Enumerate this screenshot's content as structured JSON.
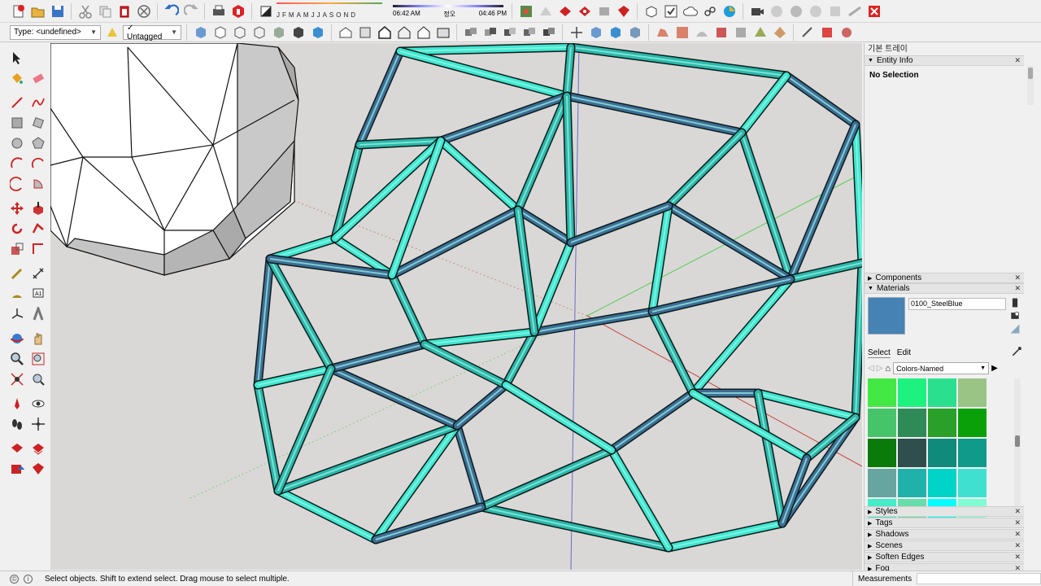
{
  "toolbar": {
    "type_label": "Type: <undefined>",
    "tag_value": "Untagged",
    "months": [
      "J",
      "F",
      "M",
      "A",
      "M",
      "J",
      "J",
      "A",
      "S",
      "O",
      "N",
      "D"
    ],
    "time_start": "06:42 AM",
    "time_noon": "정오",
    "time_end": "04:46 PM"
  },
  "tray": {
    "title": "기본 트레이",
    "entity_info": {
      "label": "Entity Info",
      "value": "No Selection"
    },
    "components": {
      "label": "Components"
    },
    "materials": {
      "label": "Materials",
      "material_name": "0100_SteelBlue",
      "current_color": "#4682b4",
      "tab_select": "Select",
      "tab_edit": "Edit",
      "collection": "Colors-Named",
      "swatches": [
        "#44e844",
        "#1ef27e",
        "#2ae08e",
        "#99c486",
        "#46c46a",
        "#2e8b57",
        "#2aa02a",
        "#0aa00a",
        "#0a7a0a",
        "#2f4f4f",
        "#108a7a",
        "#0f9a8a",
        "#66a5a0",
        "#20b2aa",
        "#00d4c8",
        "#40e0d0",
        "#44ecc8",
        "#66ddaa",
        "#00ffff",
        "#80ffd4"
      ]
    },
    "collapsed": [
      "Styles",
      "Tags",
      "Shadows",
      "Scenes",
      "Soften Edges",
      "Fog"
    ]
  },
  "status": {
    "message": "Select objects. Shift to extend select. Drag mouse to select multiple.",
    "measurements_label": "Measurements"
  },
  "colors": {
    "frame_light": "#3ee8d0",
    "frame_mid": "#2bb8aa",
    "frame_dark": "#3c6e96",
    "viewport_bg": "#d9d8d6"
  }
}
